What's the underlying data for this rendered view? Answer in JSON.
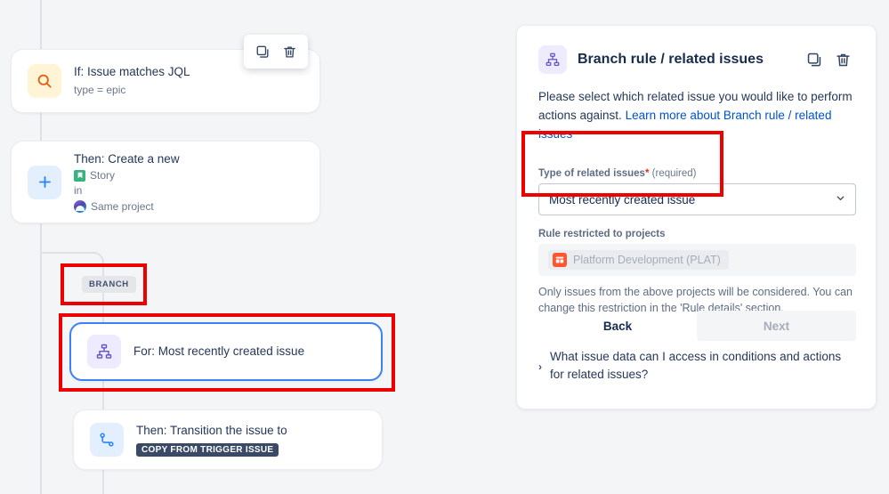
{
  "theme": {
    "page_bg": "#f4f5f7",
    "accent_blue": "#0052cc",
    "selection_blue": "#3b82f6",
    "annotation_red": "#ee0000",
    "branch_purple": "#6554c0",
    "required_red": "#de350b"
  },
  "flow": {
    "trigger_card": {
      "icon": "jql-search-icon",
      "title": "If: Issue matches JQL",
      "subtitle": "type = epic"
    },
    "card_toolbar": {
      "copy_label": "copy-icon",
      "delete_label": "trash-icon"
    },
    "create_card": {
      "icon": "plus-icon",
      "title": "Then: Create a new",
      "issue_type": "Story",
      "connector_word": "in",
      "project": "Same project"
    },
    "branch_pill": "BRANCH",
    "branch_card": {
      "icon": "branch-hierarchy-icon",
      "title": "For: Most recently created issue"
    },
    "transition_card": {
      "icon": "transition-icon",
      "title": "Then: Transition the issue to",
      "chip": "COPY FROM TRIGGER ISSUE"
    }
  },
  "panel": {
    "icon": "branch-hierarchy-icon",
    "title": "Branch rule / related issues",
    "toolbar": {
      "copy_label": "copy-icon",
      "delete_label": "trash-icon"
    },
    "description_prefix": "Please select which related issue you would like to perform actions against. ",
    "description_link": "Learn more about Branch rule / related issues",
    "type_field": {
      "label": "Type of related issues",
      "required_star": "*",
      "required_note": "(required)",
      "value": "Most recently created issue",
      "caret": "chevron-down-icon"
    },
    "projects_field": {
      "label": "Rule restricted to projects",
      "chip": "Platform Development (PLAT)",
      "help": "Only issues from the above projects will be considered. You can change this restriction in the 'Rule details' section."
    },
    "actions": {
      "back_label": "Back",
      "next_label": "Next"
    },
    "faq": {
      "chevron": "›",
      "text": "What issue data can I access in conditions and actions for related issues?"
    }
  },
  "annotations": {
    "branch_pill_box": "highlight-branch-label",
    "branch_card_box": "highlight-branch-card",
    "type_field_box": "highlight-type-field"
  }
}
